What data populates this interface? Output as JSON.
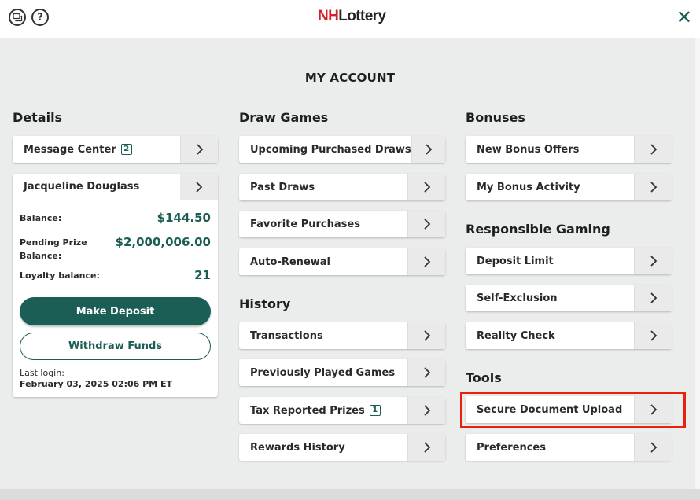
{
  "header": {
    "logo_nh": "NH",
    "logo_rest": "Lottery",
    "help_glyph": "?",
    "close_glyph": "✕",
    "icons": [
      "chat-icon",
      "help-icon",
      "close-icon"
    ]
  },
  "page_title": "MY ACCOUNT",
  "colors": {
    "accent": "#1b5e56",
    "logo_red": "#d42026",
    "highlight": "#e8210c",
    "background": "#ebedec"
  },
  "details": {
    "title": "Details",
    "message_center": {
      "label": "Message Center",
      "badge": "2"
    },
    "account": {
      "name": "Jacqueline Douglass",
      "balance_label": "Balance:",
      "balance_value": "$144.50",
      "pending_label_1": "Pending Prize",
      "pending_label_2": "Balance:",
      "pending_value": "$2,000,006.00",
      "loyalty_label": "Loyalty balance:",
      "loyalty_value": "21",
      "deposit_button": "Make Deposit",
      "withdraw_button": "Withdraw Funds",
      "last_login_label": "Last login:",
      "last_login_value": "February 03, 2025 02:06 PM ET"
    }
  },
  "draw_games": {
    "title": "Draw Games",
    "items": [
      "Upcoming Purchased Draws",
      "Past Draws",
      "Favorite Purchases",
      "Auto-Renewal"
    ]
  },
  "history": {
    "title": "History",
    "items": [
      "Transactions",
      "Previously Played Games",
      "Tax Reported Prizes",
      "Rewards History"
    ],
    "tax_badge": "1"
  },
  "bonuses": {
    "title": "Bonuses",
    "items": [
      "New Bonus Offers",
      "My Bonus Activity"
    ]
  },
  "responsible_gaming": {
    "title": "Responsible Gaming",
    "items": [
      "Deposit Limit",
      "Self-Exclusion",
      "Reality Check"
    ]
  },
  "tools": {
    "title": "Tools",
    "items": [
      "Secure Document Upload",
      "Preferences"
    ]
  }
}
